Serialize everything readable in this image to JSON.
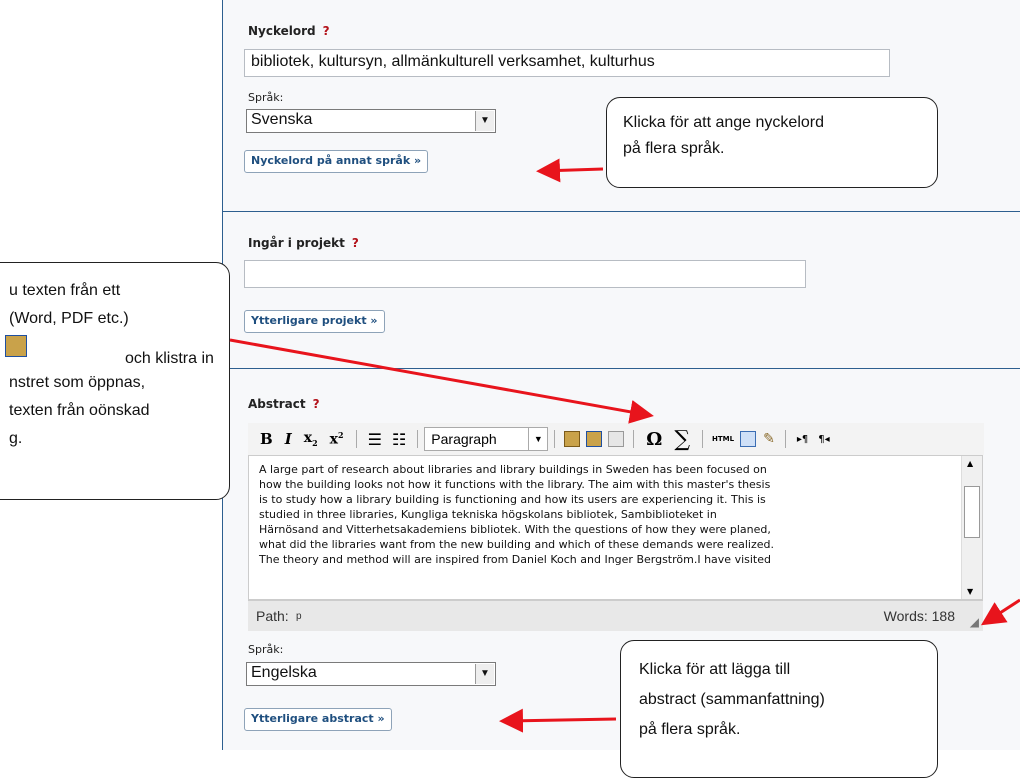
{
  "keywords": {
    "label": "Nyckelord",
    "help": "?",
    "value": "bibliotek, kultursyn, allmänkulturell verksamhet, kulturhus",
    "lang_label": "Språk:",
    "lang_value": "Svenska",
    "more_button": "Nyckelord på annat språk »"
  },
  "project": {
    "label": "Ingår i projekt",
    "help": "?",
    "value": "",
    "more_button": "Ytterligare projekt »"
  },
  "abstract": {
    "label": "Abstract",
    "help": "?",
    "toolbar": {
      "bold": "B",
      "italic": "I",
      "subscript": "x",
      "superscript": "x",
      "format_select": "Paragraph",
      "omega": "Ω",
      "sigma": "∑",
      "html": "HTML"
    },
    "text_lines": [
      "A large part of research about libraries and library buildings in Sweden has been focused on",
      "how the building looks not how it functions with the library. The aim with this master's thesis",
      "is to study how a library building is functioning and how its users are experiencing it. This is",
      "studied in three libraries, Kungliga tekniska högskolans bibliotek, Sambiblioteket in",
      "Härnösand and Vitterhetsakademiens bibliotek. With the questions of how they were planed,",
      "what did the libraries want from the new building and which of these demands were realized.",
      "The theory and method will are inspired from Daniel Koch and Inger Bergström.I have visited"
    ],
    "path_label": "Path:",
    "path_value": "p",
    "words": "Words: 188",
    "lang_label": "Språk:",
    "lang_value": "Engelska",
    "more_button": "Ytterligare abstract »"
  },
  "callouts": {
    "keywords_1": "Klicka för att ange nyckelord",
    "keywords_2": "på flera språk.",
    "paste_1": "u texten från ett",
    "paste_2": "(Word, PDF etc.)",
    "paste_3": "och klistra in",
    "paste_4": "nstret som öppnas,",
    "paste_5": "texten från oönskad",
    "paste_6": "g.",
    "abstract_1": "Klicka för att lägga till",
    "abstract_2": "abstract (sammanfattning)",
    "abstract_3": "på flera språk."
  },
  "colors": {
    "divider": "#2d5f8f",
    "help_mark": "#b3121a",
    "arrow": "#e8141c",
    "button_text": "#1f4f7f"
  }
}
